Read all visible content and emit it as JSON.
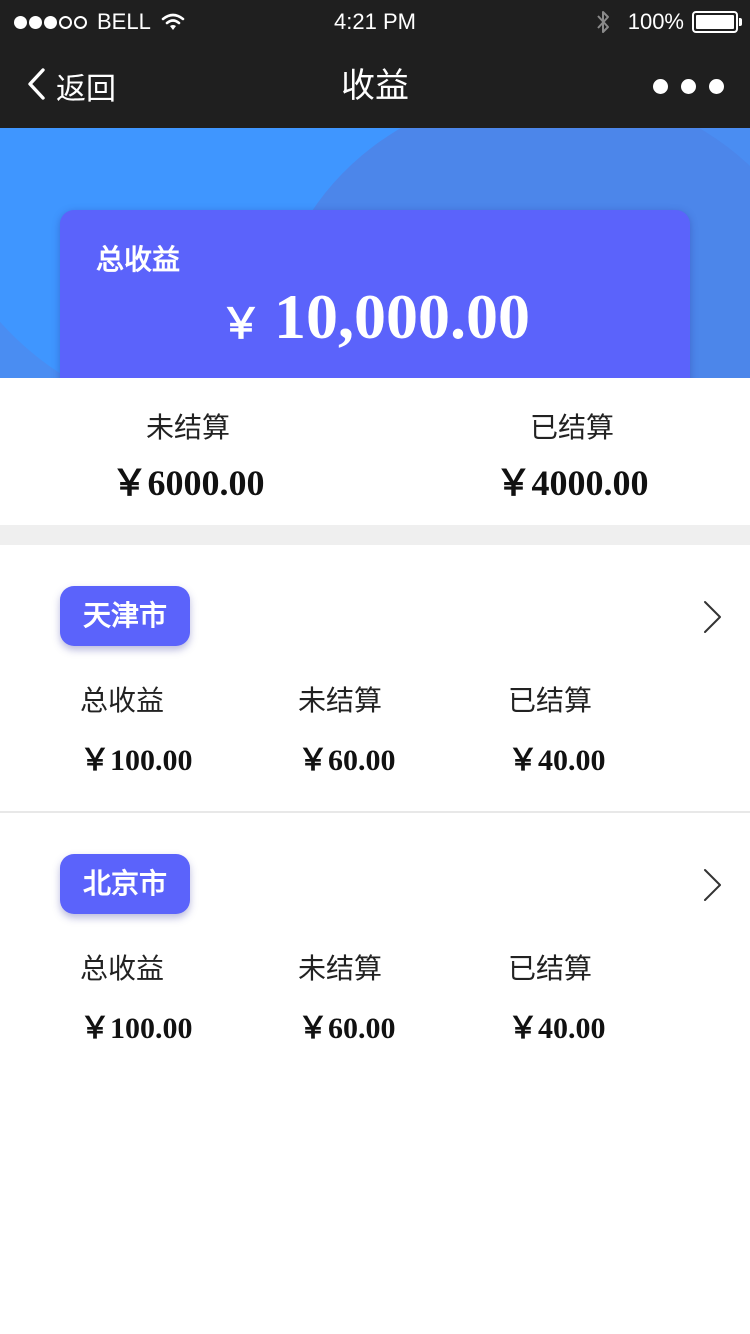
{
  "status_bar": {
    "carrier": "BELL",
    "time": "4:21 PM",
    "battery": "100%",
    "icons": [
      "signal-dots-icon",
      "wifi-icon",
      "bluetooth-icon",
      "battery-icon"
    ]
  },
  "nav": {
    "back_label": "返回",
    "title": "收益",
    "icons": [
      "chevron-left-icon",
      "more-dots-icon"
    ]
  },
  "total_card": {
    "label": "总收益",
    "currency": "￥",
    "amount": "10,000.00"
  },
  "summary": {
    "unsettled_label": "未结算",
    "unsettled_value": "￥6000.00",
    "settled_label": "已结算",
    "settled_value": "￥4000.00"
  },
  "cities": [
    {
      "name": "天津市",
      "total_label": "总收益",
      "total_value": "￥100.00",
      "unsettled_label": "未结算",
      "unsettled_value": "￥60.00",
      "settled_label": "已结算",
      "settled_value": "￥40.00"
    },
    {
      "name": "北京市",
      "total_label": "总收益",
      "total_value": "￥100.00",
      "unsettled_label": "未结算",
      "unsettled_value": "￥60.00",
      "settled_label": "已结算",
      "settled_value": "￥40.00"
    }
  ],
  "colors": {
    "bar_background": "#1f1f1f",
    "hero_blue": "#4a8df2",
    "accent_purple": "#5b63fb",
    "divider_gray": "#efefef"
  }
}
